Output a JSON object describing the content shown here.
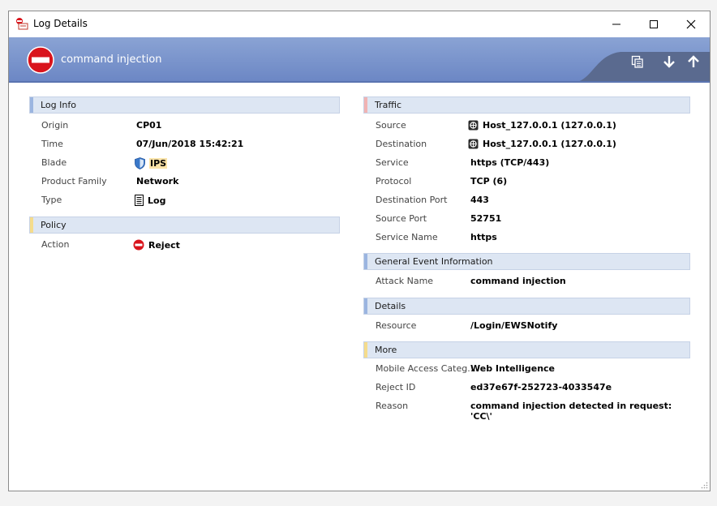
{
  "window": {
    "title": "Log Details"
  },
  "header": {
    "title": "command injection"
  },
  "colors": {
    "header_blue": "#7a94cc",
    "section_bg": "#dde6f3",
    "accent_blue": "#9bb5e0",
    "accent_yellow": "#f5dc8c",
    "accent_red": "#f1b3b3",
    "reject_red": "#d9141c"
  },
  "log_info": {
    "heading": "Log Info",
    "rows": [
      {
        "label": "Origin",
        "value": "CP01"
      },
      {
        "label": "Time",
        "value": "07/Jun/2018 15:42:21"
      },
      {
        "label": "Blade",
        "value": "IPS"
      },
      {
        "label": "Product Family",
        "value": "Network"
      },
      {
        "label": "Type",
        "value": "Log"
      }
    ]
  },
  "policy": {
    "heading": "Policy",
    "rows": [
      {
        "label": "Action",
        "value": "Reject"
      }
    ]
  },
  "traffic": {
    "heading": "Traffic",
    "rows": [
      {
        "label": "Source",
        "value": "Host_127.0.0.1 (127.0.0.1)"
      },
      {
        "label": "Destination",
        "value": "Host_127.0.0.1 (127.0.0.1)"
      },
      {
        "label": "Service",
        "value": "https (TCP/443)"
      },
      {
        "label": "Protocol",
        "value": "TCP (6)"
      },
      {
        "label": "Destination Port",
        "value": "443"
      },
      {
        "label": "Source Port",
        "value": "52751"
      },
      {
        "label": "Service Name",
        "value": "https"
      }
    ]
  },
  "general_event": {
    "heading": "General Event Information",
    "rows": [
      {
        "label": "Attack Name",
        "value": "command injection"
      }
    ]
  },
  "details": {
    "heading": "Details",
    "rows": [
      {
        "label": "Resource",
        "value": "/Login/EWSNotify"
      }
    ]
  },
  "more": {
    "heading": "More",
    "rows": [
      {
        "label": "Mobile Access Categ...",
        "value": "Web Intelligence"
      },
      {
        "label": "Reject ID",
        "value": "ed37e67f-252723-4033547e"
      },
      {
        "label": "Reason",
        "value": "command injection detected in request: 'CC\\'"
      }
    ]
  }
}
